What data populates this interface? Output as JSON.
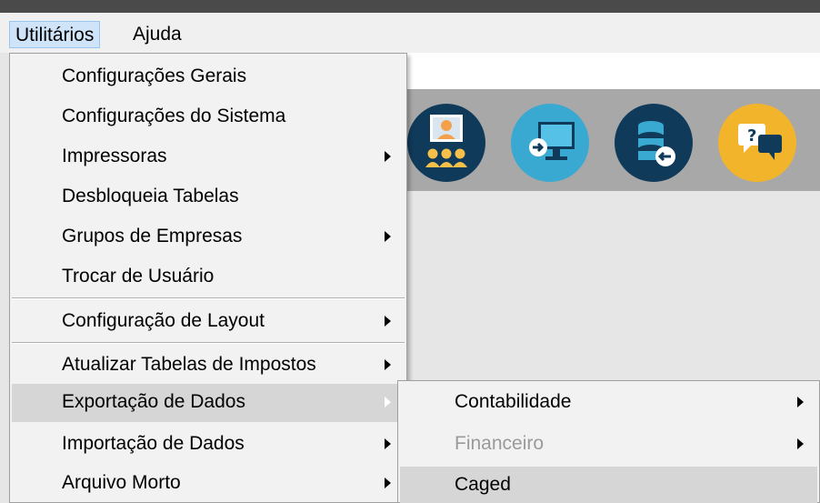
{
  "menubar": {
    "utilitarios": "Utilitários",
    "ajuda": "Ajuda"
  },
  "toolbar": {
    "icons": [
      "meeting-icon",
      "screen-import-icon",
      "database-import-icon",
      "help-chat-icon"
    ],
    "colors": {
      "background": "#a8a8a8",
      "dark_blue": "#0f3a5a",
      "light_blue": "#39a9d2",
      "yellow": "#f2b42a"
    }
  },
  "main_menu": {
    "items": [
      {
        "label": "Configurações Gerais",
        "submenu": false
      },
      {
        "label": "Configurações do Sistema",
        "submenu": false
      },
      {
        "label": "Impressoras",
        "submenu": true
      },
      {
        "label": "Desbloqueia Tabelas",
        "submenu": false
      },
      {
        "label": "Grupos de Empresas",
        "submenu": true
      },
      {
        "label": "Trocar de Usuário",
        "submenu": false
      },
      {
        "label": "Configuração de Layout",
        "submenu": true
      },
      {
        "label": "Atualizar Tabelas de Impostos",
        "submenu": true
      },
      {
        "label": "Exportação de Dados",
        "submenu": true,
        "highlighted": true
      },
      {
        "label": "Importação de Dados",
        "submenu": true
      },
      {
        "label": "Arquivo Morto",
        "submenu": true
      }
    ]
  },
  "sub_menu": {
    "items": [
      {
        "label": "Contabilidade",
        "submenu": true
      },
      {
        "label": "Financeiro",
        "submenu": true,
        "disabled": true
      },
      {
        "label": "Caged",
        "submenu": false,
        "highlighted": true
      }
    ]
  }
}
